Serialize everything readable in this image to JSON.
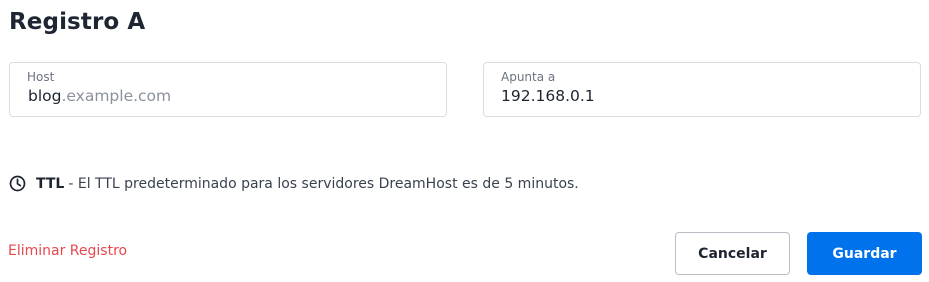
{
  "title": "Registro A",
  "host_field": {
    "label": "Host",
    "value": "blog",
    "suffix": ".example.com"
  },
  "points_to_field": {
    "label": "Apunta a",
    "value": "192.168.0.1"
  },
  "ttl": {
    "icon": "clock-icon",
    "label": "TTL",
    "text": "- El TTL predeterminado para los servidores DreamHost es de 5 minutos."
  },
  "actions": {
    "delete_label": "Eliminar Registro",
    "cancel_label": "Cancelar",
    "save_label": "Guardar"
  },
  "colors": {
    "primary": "#0073ec",
    "danger": "#e5484d"
  }
}
